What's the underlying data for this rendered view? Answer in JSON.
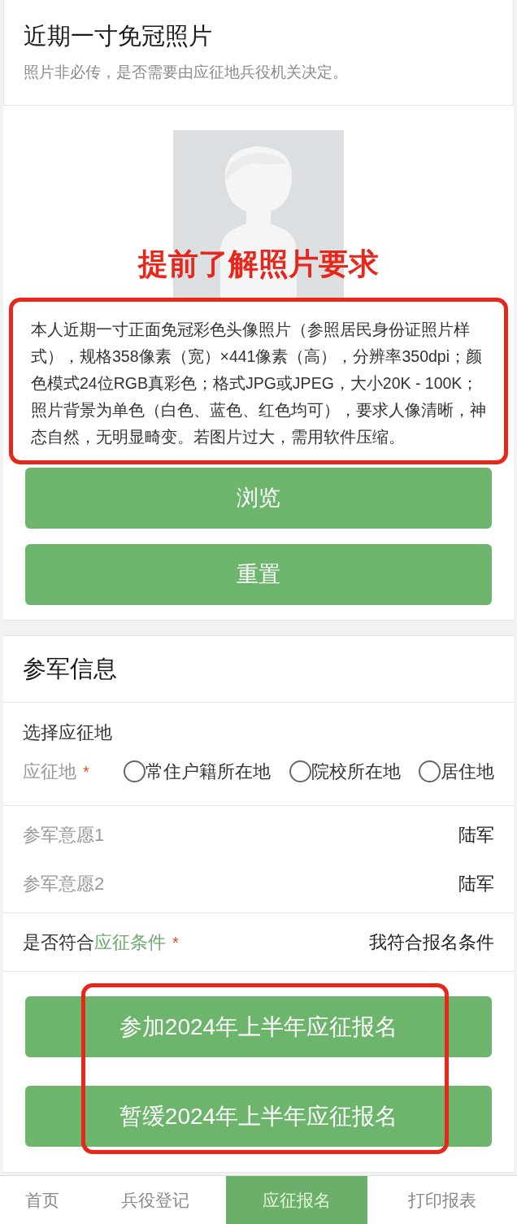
{
  "photo_section": {
    "title": "近期一寸免冠照片",
    "note": "照片非必传，是否需要由应征地兵役机关决定。",
    "annotation_caption": "提前了解照片要求",
    "requirements": "本人近期一寸正面免冠彩色头像照片（参照居民身份证照片样式），规格358像素（宽）×441像素（高），分辨率350dpi；颜色模式24位RGB真彩色；格式JPG或JPEG，大小20K - 100K；照片背景为单色（白色、蓝色、红色均可），要求人像清晰，神态自然，无明显畸变。若图片过大，需用软件压缩。",
    "buttons": [
      "浏览",
      "重置"
    ]
  },
  "military_section": {
    "title": "参军信息",
    "select_label": "选择应征地",
    "field_label": "应征地",
    "required_mark": "*",
    "options": [
      {
        "label": "常住户籍所在地",
        "selected": false
      },
      {
        "label": "院校所在地",
        "selected": false
      },
      {
        "label": "居住地",
        "selected": false
      }
    ],
    "wishes": [
      {
        "label": "参军意愿1",
        "value": "陆军"
      },
      {
        "label": "参军意愿2",
        "value": "陆军"
      }
    ],
    "eligibility": {
      "label": "是否符合",
      "link": "应征条件",
      "required_mark": "*",
      "value": "我符合报名条件"
    }
  },
  "actions": [
    "参加2024年上半年应征报名",
    "暂缓2024年上半年应征报名"
  ],
  "nav": [
    {
      "label": "首页",
      "selected": false
    },
    {
      "label": "兵役登记",
      "selected": false
    },
    {
      "label": "应征报名",
      "selected": true
    },
    {
      "label": "打印报表",
      "selected": false
    }
  ]
}
